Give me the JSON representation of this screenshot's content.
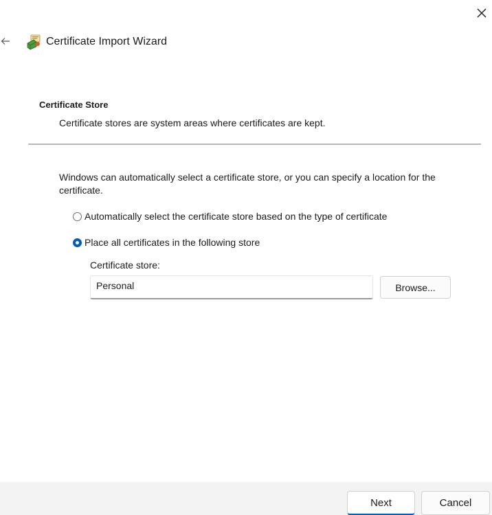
{
  "window": {
    "title": "Certificate Import Wizard",
    "app_icon": "certificate-wizard-icon",
    "close_icon": "close-icon",
    "back_icon": "back-arrow-icon"
  },
  "section": {
    "heading": "Certificate Store",
    "description": "Certificate stores are system areas where certificates are kept."
  },
  "body": {
    "intro": "Windows can automatically select a certificate store, or you can specify a location for the certificate.",
    "options": [
      {
        "label": "Automatically select the certificate store based on the type of certificate",
        "selected": false
      },
      {
        "label": "Place all certificates in the following store",
        "selected": true
      }
    ],
    "store_label": "Certificate store:",
    "store_value": "Personal",
    "browse_label": "Browse..."
  },
  "footer": {
    "next_label": "Next",
    "cancel_label": "Cancel"
  },
  "colors": {
    "accent": "#005fb8",
    "footer_bg": "#f3f3f3",
    "divider": "#b8b8b8"
  }
}
